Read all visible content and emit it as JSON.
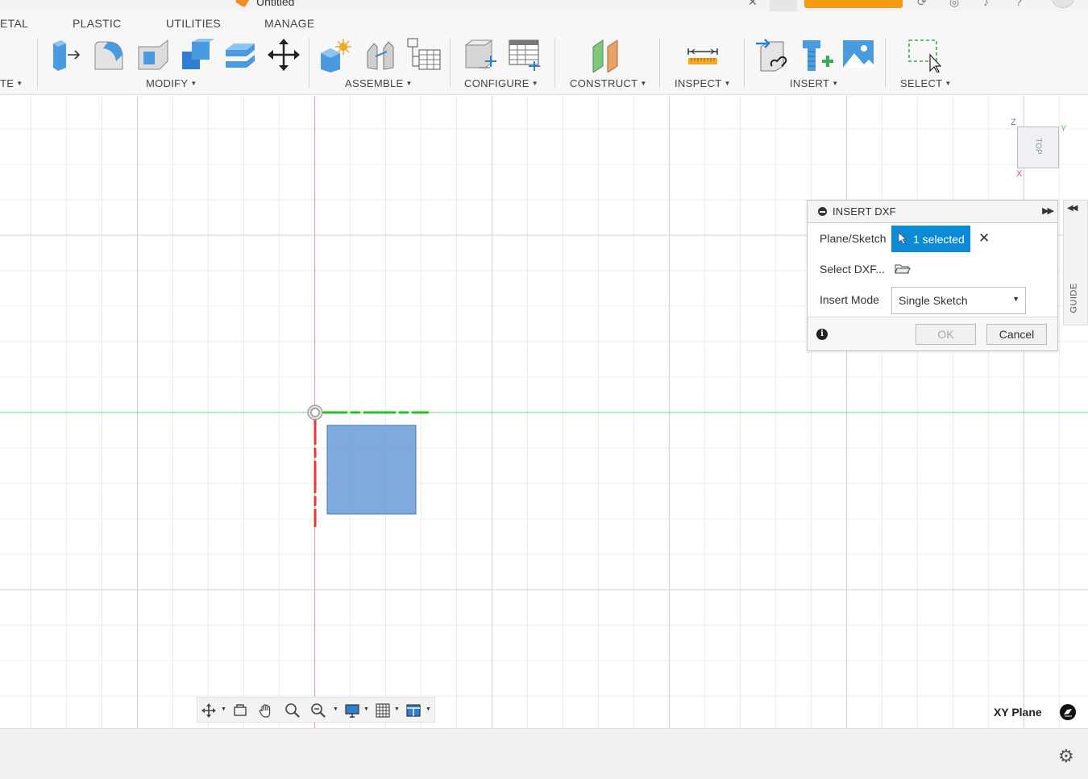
{
  "window": {
    "document_title": "Untitled"
  },
  "toolbar": {
    "tabs": [
      "ETAL",
      "PLASTIC",
      "UTILITIES",
      "MANAGE"
    ],
    "groups": {
      "create": "TE",
      "modify": "MODIFY",
      "assemble": "ASSEMBLE",
      "configure": "CONFIGURE",
      "construct": "CONSTRUCT",
      "inspect": "INSPECT",
      "insert": "INSERT",
      "select": "SELECT"
    }
  },
  "viewcube": {
    "face": "TOP",
    "axis_z": "Z",
    "axis_y": "Y",
    "axis_x": "X"
  },
  "dialog": {
    "title": "INSERT DXF",
    "plane_label": "Plane/Sketch",
    "plane_value": "1 selected",
    "select_label": "Select DXF...",
    "mode_label": "Insert Mode",
    "mode_value": "Single Sketch",
    "ok": "OK",
    "cancel": "Cancel"
  },
  "guide": {
    "label": "GUIDE"
  },
  "status": {
    "plane": "XY Plane"
  },
  "colors": {
    "accent": "#0d8ad6",
    "x_axis": "#e53935",
    "y_axis": "#52d452",
    "sketch_fill": "#6b9bd6"
  }
}
